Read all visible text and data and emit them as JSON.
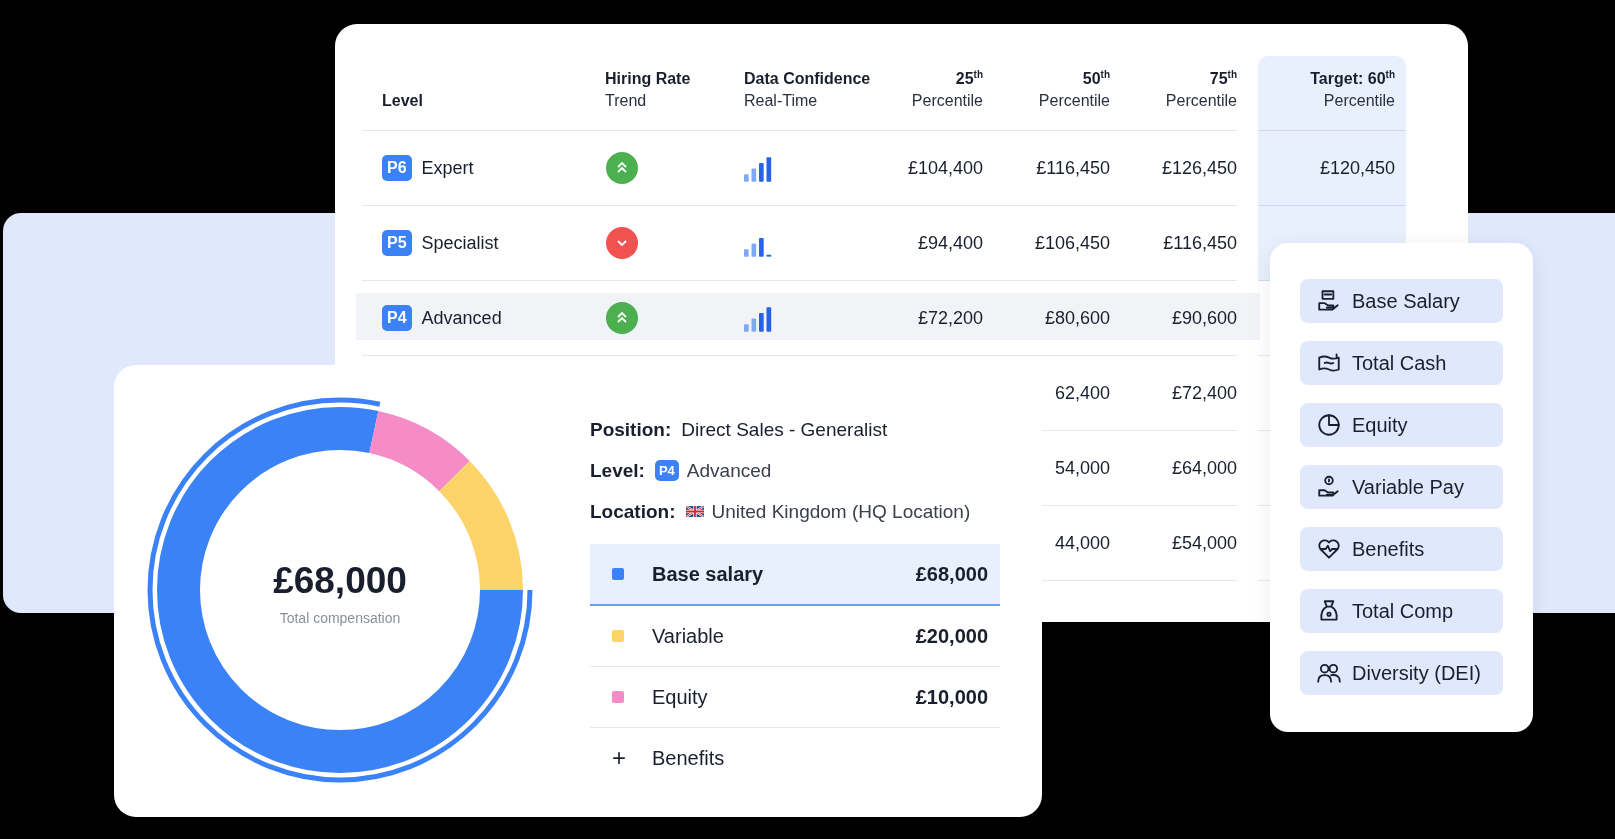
{
  "table": {
    "columns": [
      {
        "title": "Level"
      },
      {
        "title": "Hiring Rate",
        "subtitle": "Trend"
      },
      {
        "title": "Data Confidence",
        "subtitle": "Real-Time"
      },
      {
        "title": "25",
        "sup": "th",
        "subtitle": "Percentile"
      },
      {
        "title": "50",
        "sup": "th",
        "subtitle": "Percentile"
      },
      {
        "title": "75",
        "sup": "th",
        "subtitle": "Percentile"
      },
      {
        "title": "Target: 60",
        "sup": "th",
        "subtitle": "Percentile"
      }
    ],
    "rows": [
      {
        "badge": "P6",
        "name": "Expert",
        "trending_up": true,
        "confidence_full": true,
        "p25": "£104,400",
        "p50": "£116,450",
        "p75": "£126,450",
        "target": "£120,450",
        "selected": false
      },
      {
        "badge": "P5",
        "name": "Specialist",
        "trending_up": false,
        "confidence_full": false,
        "p25": "£94,400",
        "p50": "£106,450",
        "p75": "£116,450",
        "selected": false
      },
      {
        "badge": "P4",
        "name": "Advanced",
        "trending_up": true,
        "confidence_full": true,
        "p25": "£72,200",
        "p50": "£80,600",
        "p75": "£90,600",
        "selected": true
      },
      {
        "p50": "62,400",
        "p75": "£72,400",
        "selected": false
      },
      {
        "p50": "54,000",
        "p75": "£64,000",
        "selected": false
      },
      {
        "p50": "44,000",
        "p75": "£54,000",
        "selected": false
      }
    ]
  },
  "summary": {
    "center_value": "£68,000",
    "center_label": "Total compensation",
    "details": [
      {
        "kind": "text",
        "label": "Position:",
        "value": "Direct Sales - Generalist"
      },
      {
        "kind": "badge",
        "label": "Level:",
        "badge": "P4",
        "value": "Advanced"
      },
      {
        "kind": "flag",
        "label": "Location:",
        "value": "United Kingdom (HQ Location)"
      }
    ],
    "legend": [
      {
        "kind": "item",
        "label": "Base salary",
        "amount": "£68,000",
        "color": "#3b82f6",
        "selected": true
      },
      {
        "kind": "item",
        "label": "Variable",
        "amount": "£20,000",
        "color": "#fcd46a",
        "selected": false
      },
      {
        "kind": "item",
        "label": "Equity",
        "amount": "£10,000",
        "color": "#f58cc8",
        "selected": false
      },
      {
        "kind": "add",
        "icon": "+",
        "label": "Benefits",
        "selected": false
      }
    ]
  },
  "menu": {
    "items": [
      {
        "label": "Base Salary"
      },
      {
        "label": "Total Cash"
      },
      {
        "label": "Equity"
      },
      {
        "label": "Variable Pay"
      },
      {
        "label": "Benefits"
      },
      {
        "label": "Total Comp"
      },
      {
        "label": "Diversity (DEI)"
      }
    ]
  }
}
